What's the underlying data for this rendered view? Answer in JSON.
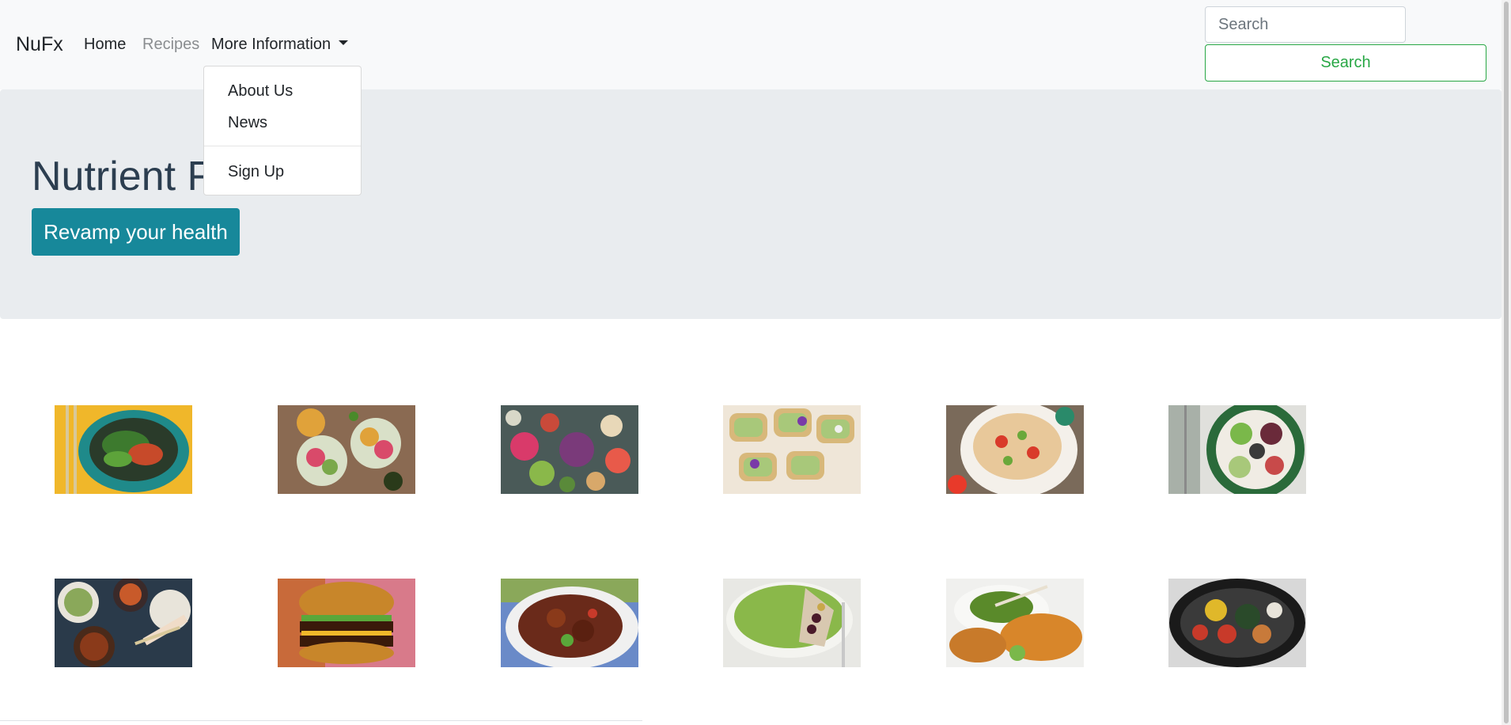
{
  "navbar": {
    "brand": "NuFx",
    "home": "Home",
    "recipes": "Recipes",
    "more_information": "More Information",
    "search_placeholder": "Search",
    "search_button": "Search"
  },
  "dropdown": {
    "about_us": "About Us",
    "news": "News",
    "sign_up": "Sign Up"
  },
  "hero": {
    "title": "Nutrient F",
    "button": "Revamp your health"
  },
  "gallery": {
    "row1": [
      "noodle-salad-bowl",
      "buddha-bowls",
      "vegetable-spread",
      "avocado-toasts",
      "pasta-salad",
      "grain-bowl"
    ],
    "row2": [
      "asian-dishes",
      "cheeseburger",
      "glazed-pork",
      "green-smoothie-bowl",
      "chicken-with-green-sauce",
      "vegetable-skillet"
    ]
  },
  "colors": {
    "navbar_bg": "#f8f9fa",
    "jumbotron_bg": "#e9ecef",
    "hero_button": "#17889a",
    "search_button": "#28a745"
  }
}
